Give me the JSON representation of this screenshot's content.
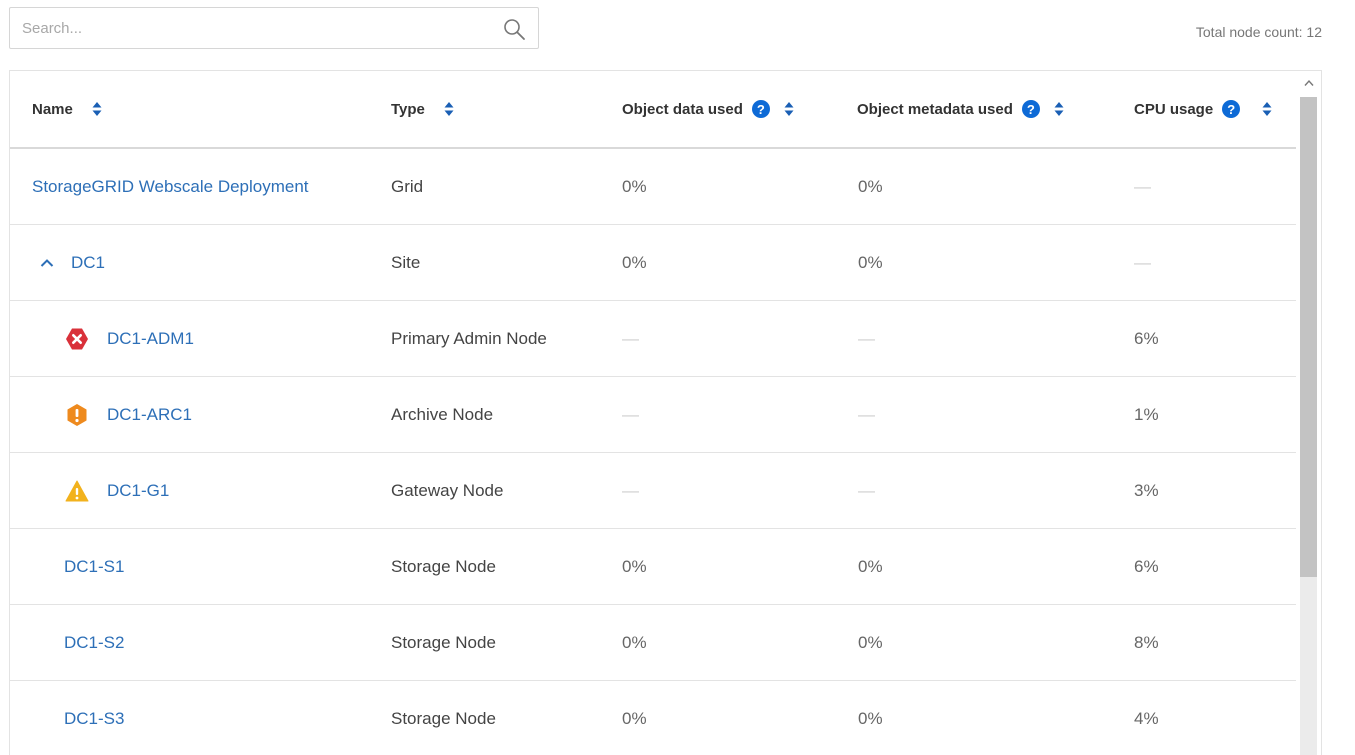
{
  "search": {
    "placeholder": "Search..."
  },
  "summary": {
    "label": "Total node count: 12"
  },
  "table": {
    "headers": {
      "name": "Name",
      "type": "Type",
      "object_data": "Object data used",
      "object_metadata": "Object metadata used",
      "cpu": "CPU usage",
      "help_glyph": "?"
    },
    "rows": [
      {
        "name": "StorageGRID Webscale Deployment",
        "type": "Grid",
        "object_data": "0%",
        "object_metadata": "0%",
        "cpu": "—"
      },
      {
        "name": "DC1",
        "type": "Site",
        "object_data": "0%",
        "object_metadata": "0%",
        "cpu": "—",
        "expanded": true
      },
      {
        "name": "DC1-ADM1",
        "type": "Primary Admin Node",
        "object_data": "—",
        "object_metadata": "—",
        "cpu": "6%",
        "status_icon": "critical-error-icon",
        "status_color": "#d9313a"
      },
      {
        "name": "DC1-ARC1",
        "type": "Archive Node",
        "object_data": "—",
        "object_metadata": "—",
        "cpu": "1%",
        "status_icon": "major-alert-icon",
        "status_color": "#ee8a1e"
      },
      {
        "name": "DC1-G1",
        "type": "Gateway Node",
        "object_data": "—",
        "object_metadata": "—",
        "cpu": "3%",
        "status_icon": "minor-warning-icon",
        "status_color": "#f2b21d"
      },
      {
        "name": "DC1-S1",
        "type": "Storage Node",
        "object_data": "0%",
        "object_metadata": "0%",
        "cpu": "6%"
      },
      {
        "name": "DC1-S2",
        "type": "Storage Node",
        "object_data": "0%",
        "object_metadata": "0%",
        "cpu": "8%"
      },
      {
        "name": "DC1-S3",
        "type": "Storage Node",
        "object_data": "0%",
        "object_metadata": "0%",
        "cpu": "4%"
      }
    ]
  },
  "colors": {
    "link": "#2d6fb7",
    "help_icon": "#0d6ad6",
    "sort_icon": "#1a5fb4"
  }
}
